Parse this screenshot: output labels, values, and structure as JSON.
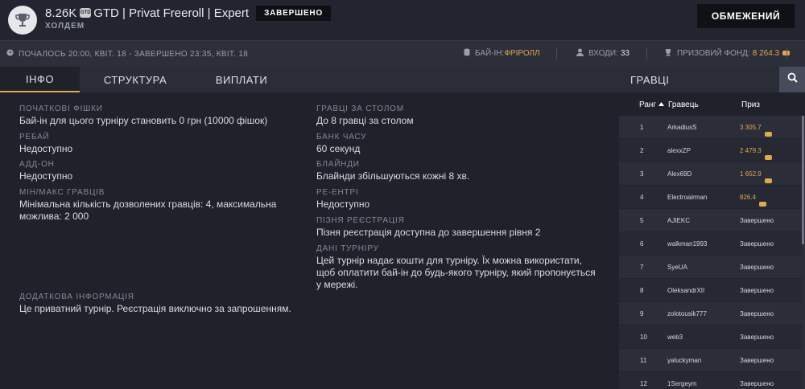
{
  "header": {
    "amount": "8.26K",
    "coin_label": "GTD",
    "currency": "GTD",
    "tournament_name": "Privat Freeroll",
    "level": "Expert",
    "status_badge": "ЗАВЕРШЕНО",
    "game": "ХОЛДЕМ",
    "limits_button": "ОБМЕЖЕНИЙ"
  },
  "infobar": {
    "time_text": "ПОЧАЛОСЬ 20:00, КВІТ. 18 - ЗАВЕРШЕНО 23:35, КВІТ. 18",
    "buyin_label": "БАЙ-ІН:",
    "buyin_value": "ФРІРОЛЛ",
    "entries_label": "ВХОДИ:",
    "entries_value": "33",
    "prize_label": "ПРИЗОВИЙ ФОНД:",
    "prize_value": "8 264.3"
  },
  "tabs": [
    "ІНФО",
    "СТРУКТУРА",
    "ВИПЛАТИ"
  ],
  "players_title": "ГРАВЦІ",
  "info": {
    "starting_chips_label": "ПОЧАТКОВІ ФІШКИ",
    "starting_chips_value": "Бай-ін для цього турніру становить 0 грн (10000 фішок)",
    "rebuy_label": "РЕБАЙ",
    "rebuy_value": "Недоступно",
    "addon_label": "АДД-ОН",
    "addon_value": "Недоступно",
    "minmax_label": "МІН/МАКС ГРАВЦІВ",
    "minmax_value": "Мінімальна кількість дозволених гравців: 4, максимальна можлива: 2 000",
    "extra_label": "ДОДАТКОВА ІНФОРМАЦІЯ",
    "extra_value": "Це приватний турнір. Реєстрація виключно за запрошенням.",
    "players_table_label": "ГРАВЦІ ЗА СТОЛОМ",
    "players_table_value": "До 8 гравці за столом",
    "time_bank_label": "БАНК ЧАСУ",
    "time_bank_value": "60 секунд",
    "blinds_label": "БЛАЙНДИ",
    "blinds_value": "Блайнди збільшуються кожні 8 хв.",
    "reentry_label": "РЕ-ЕНТРІ",
    "reentry_value": "Недоступно",
    "late_reg_label": "ПІЗНЯ РЕЄСТРАЦІЯ",
    "late_reg_value": "Пізня реєстрація доступна до завершення рівня 2",
    "tournament_data_label": "ДАНІ ТУРНІРУ",
    "tournament_data_value": "Цей турнір надає кошти для турніру. Їх можна використати, щоб оплатити бай-ін до будь-якого турніру, який пропонується у мережі."
  },
  "players_table": {
    "col_rank": "Ранг",
    "col_player": "Гравець",
    "col_prize": "Приз",
    "rows": [
      {
        "rank": "1",
        "name": "ArkadiusS",
        "prize": "3 305.7",
        "paid": true
      },
      {
        "rank": "2",
        "name": "alexxZP",
        "prize": "2 479.3",
        "paid": true
      },
      {
        "rank": "3",
        "name": "Alex69D",
        "prize": "1 652.9",
        "paid": true
      },
      {
        "rank": "4",
        "name": "Electroairman",
        "prize": "826.4",
        "paid": true
      },
      {
        "rank": "5",
        "name": "AJIEKC",
        "prize": "Завершено",
        "paid": false
      },
      {
        "rank": "6",
        "name": "walkman1993",
        "prize": "Завершено",
        "paid": false
      },
      {
        "rank": "7",
        "name": "SyeUA",
        "prize": "Завершено",
        "paid": false
      },
      {
        "rank": "8",
        "name": "OleksandrXII",
        "prize": "Завершено",
        "paid": false
      },
      {
        "rank": "9",
        "name": "zolotousik777",
        "prize": "Завершено",
        "paid": false
      },
      {
        "rank": "10",
        "name": "web3",
        "prize": "Завершено",
        "paid": false
      },
      {
        "rank": "11",
        "name": "yaluckyman",
        "prize": "Завершено",
        "paid": false
      },
      {
        "rank": "12",
        "name": "1Sergeym",
        "prize": "Завершено",
        "paid": false
      }
    ]
  },
  "colors": {
    "accent_gold": "#e1a94b",
    "background": "#1f222b",
    "header": "#22252f"
  },
  "icons": [
    "trophy-icon",
    "clock-icon",
    "coins-icon",
    "user-icon",
    "cup-icon",
    "search-icon",
    "sort-up-icon",
    "chip-icon"
  ]
}
